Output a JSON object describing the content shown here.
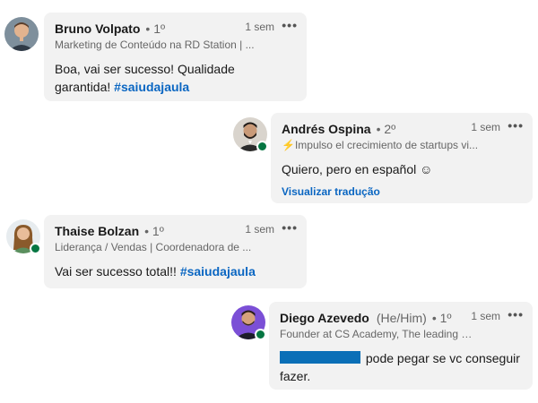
{
  "comments": [
    {
      "name": "Bruno Volpato",
      "degree": "• 1º",
      "headline": "Marketing de Conteúdo na RD Station | ...",
      "time": "1 sem",
      "text_part1": "Boa, vai ser sucesso! Qualidade garantida! ",
      "hashtag": "#saiudajaula"
    },
    {
      "name": "Andrés Ospina",
      "degree": "• 2º",
      "headline": "⚡Impulso el crecimiento de startups vi...",
      "time": "1 sem",
      "text": "Quiero, pero en español ☺",
      "translate_label": "Visualizar tradução"
    },
    {
      "name": "Thaise Bolzan",
      "degree": "• 1º",
      "headline": "Liderança / Vendas | Coordenadora de ...",
      "time": "1 sem",
      "text_part1": "Vai ser sucesso total!! ",
      "hashtag": "#saiudajaula"
    },
    {
      "name": "Diego Azevedo",
      "pronouns": "(He/Him)",
      "degree": "• 1º",
      "headline": "Founder at CS Academy, The leading E...",
      "time": "1 sem",
      "text": "pode pegar se vc conseguir fazer."
    }
  ],
  "more_glyph": "•••",
  "colors": {
    "bubble": "#f2f2f2",
    "link": "#0a66c2",
    "presence": "#057642",
    "redaction": "#0a6fb7"
  }
}
